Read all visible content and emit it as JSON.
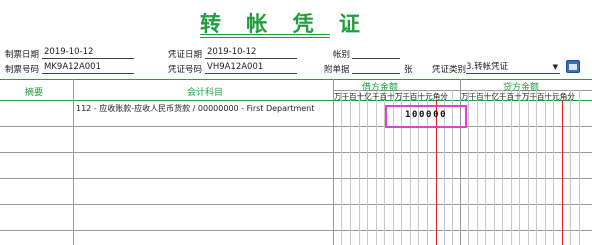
{
  "title": "转 帐 凭 证",
  "header": {
    "make_date_label": "制票日期",
    "make_date_value": "2019-10-12",
    "make_no_label": "制票号码",
    "make_no_value": "MK9A12A001",
    "voucher_date_label": "凭证日期",
    "voucher_date_value": "2019-10-12",
    "voucher_no_label": "凭证号码",
    "voucher_no_value": "VH9A12A001",
    "book_label": "帐别",
    "book_value": "",
    "attachments_label": "附单据",
    "attachments_value": "",
    "attachments_unit": "张",
    "voucher_type_label": "凭证类别",
    "voucher_type_value": "3.转帐凭证"
  },
  "table": {
    "col_summary": "摘要",
    "col_account": "会计科目",
    "col_debit": "借方金额",
    "col_credit": "贷方金额",
    "digit_units": "万千百十亿千百十万千百十元角分",
    "rows": [
      {
        "summary": "",
        "account": "112 - 应收账款-应收人民币货款 / 00000000 - First Department",
        "debit": "100000",
        "credit": ""
      }
    ]
  }
}
